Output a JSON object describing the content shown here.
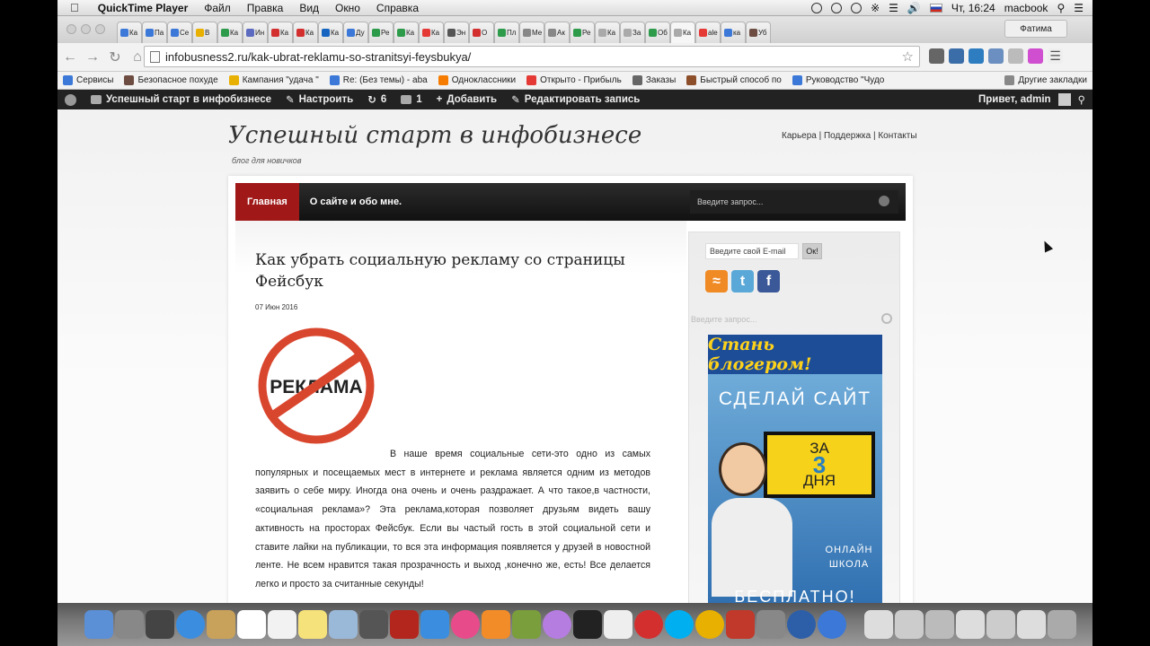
{
  "menubar": {
    "app_name": "QuickTime Player",
    "menus": [
      "Файл",
      "Правка",
      "Вид",
      "Окно",
      "Справка"
    ],
    "clock": "Чт, 16:24",
    "user": "macbook"
  },
  "browser": {
    "profile_name": "Фатима",
    "url": "infobusness2.ru/kak-ubrat-reklamu-so-stranitsyi-feysbukya/",
    "tabs": [
      {
        "label": "Ка",
        "color": "#3b78d8"
      },
      {
        "label": "Па",
        "color": "#3b78d8"
      },
      {
        "label": "Се",
        "color": "#3b78d8"
      },
      {
        "label": "В",
        "color": "#e8b000"
      },
      {
        "label": "Ка",
        "color": "#2e9b4b"
      },
      {
        "label": "Ин",
        "color": "#5c6bc0"
      },
      {
        "label": "Ка",
        "color": "#d32f2f"
      },
      {
        "label": "Ка",
        "color": "#d32f2f"
      },
      {
        "label": "Ка",
        "color": "#1565c0"
      },
      {
        "label": "Ду",
        "color": "#3b78d8"
      },
      {
        "label": "Ре",
        "color": "#2e9b4b"
      },
      {
        "label": "Ка",
        "color": "#2e9b4b"
      },
      {
        "label": "Ка",
        "color": "#e53935"
      },
      {
        "label": "Эн",
        "color": "#555555"
      },
      {
        "label": "О",
        "color": "#d32f2f"
      },
      {
        "label": "Пл",
        "color": "#2e9b4b"
      },
      {
        "label": "Ме",
        "color": "#888888"
      },
      {
        "label": "Ак",
        "color": "#888888"
      },
      {
        "label": "Ре",
        "color": "#2e9b4b"
      },
      {
        "label": "Ка",
        "color": "#aaaaaa"
      },
      {
        "label": "За",
        "color": "#aaaaaa"
      },
      {
        "label": "Об",
        "color": "#2e9b4b"
      },
      {
        "label": "Ка",
        "color": "#aaaaaa",
        "active": true
      },
      {
        "label": "ale",
        "color": "#e53935"
      },
      {
        "label": "ка",
        "color": "#3b78d8"
      },
      {
        "label": "Уб",
        "color": "#6d4c41"
      }
    ]
  },
  "bookmarks": [
    {
      "label": "Сервисы",
      "color": "#3b78d8"
    },
    {
      "label": "Безопасное похуде",
      "color": "#6d4c41"
    },
    {
      "label": "Кампания \"удача \"",
      "color": "#e8b000"
    },
    {
      "label": "Re: (Без темы) - aba",
      "color": "#3b78d8"
    },
    {
      "label": "Одноклассники",
      "color": "#f57c00"
    },
    {
      "label": "Открыто - Прибыль",
      "color": "#e53935"
    },
    {
      "label": "Заказы",
      "color": "#666666"
    },
    {
      "label": "Быстрый способ по",
      "color": "#8d4e2a"
    },
    {
      "label": "Руководство \"Чудо",
      "color": "#3b78d8"
    },
    {
      "label": "Другие закладки",
      "color": "#888888"
    }
  ],
  "wpbar": {
    "site_name": "Успешный старт в инфобизнесе",
    "customize": "Настроить",
    "updates": "6",
    "comments": "1",
    "add_new": "Добавить",
    "edit_post": "Редактировать запись",
    "greeting": "Привет, admin"
  },
  "site": {
    "title": "Успешный старт в инфобизнесе",
    "tagline": "блог для новичков",
    "top_links": "Карьера | Поддержка | Контакты",
    "nav_home": "Главная",
    "nav_about": "О сайте и обо мне.",
    "nav_search_placeholder": "Введите запрос..."
  },
  "post": {
    "title": "Как убрать социальную рекламу со страницы Фейсбук",
    "date": "07 Июн 2016",
    "image_text": "РЕКЛАМА",
    "body_first": "В наше время социальные сети-это одно из самых популярных и посещаемых мест в интернете и реклама является одним из методов заявить о себе миру. Иногда она очень и очень раздражает. А что такое,в частности, «социальная реклама»? Эта реклама,которая позволяет  друзьям видеть вашу активность на просторах Фейсбук. Если вы частый гость в этой социальной сети и ставите лайки на публикации, то вся эта информация появляется у друзей в новостной ленте. Не всем нравится такая прозрачность и выход ,конечно же, есть! Все делается легко и просто за считанные секунды!"
  },
  "sidebar": {
    "email_placeholder": "Введите свой E-mail",
    "email_button": "Ок!",
    "search_placeholder": "Введите запрос...",
    "banner_title": "Стань блогером!",
    "banner_line1": "СДЕЛАЙ САЙТ",
    "banner_za": "ЗА",
    "banner_num": "3",
    "banner_days": "ДНЯ",
    "banner_online": "ОНЛАЙН ШКОЛА",
    "banner_free": "БЕСПЛАТНО!"
  },
  "dock_apps": [
    {
      "name": "finder",
      "color": "#5b8fd6"
    },
    {
      "name": "launchpad",
      "color": "#888888"
    },
    {
      "name": "mission-control",
      "color": "#444444"
    },
    {
      "name": "safari",
      "color": "#3b8de0"
    },
    {
      "name": "contacts",
      "color": "#c8a15a"
    },
    {
      "name": "calendar",
      "color": "#ffffff"
    },
    {
      "name": "reminders",
      "color": "#f2f2f2"
    },
    {
      "name": "notes",
      "color": "#f6e27a"
    },
    {
      "name": "preview",
      "color": "#9ab8d8"
    },
    {
      "name": "facetime",
      "color": "#555555"
    },
    {
      "name": "photo-booth",
      "color": "#b3261e"
    },
    {
      "name": "app-store",
      "color": "#3b8de0"
    },
    {
      "name": "itunes",
      "color": "#e84b8a"
    },
    {
      "name": "ibooks",
      "color": "#f28c28"
    },
    {
      "name": "game",
      "color": "#7a9e3b"
    },
    {
      "name": "flower",
      "color": "#b57de0"
    },
    {
      "name": "activity-monitor",
      "color": "#222222"
    },
    {
      "name": "text-file",
      "color": "#eeeeee"
    },
    {
      "name": "opera",
      "color": "#d32f2f"
    },
    {
      "name": "skype",
      "color": "#00aff0"
    },
    {
      "name": "chrome",
      "color": "#e8b000"
    },
    {
      "name": "photo-app",
      "color": "#c0392b"
    },
    {
      "name": "system-preferences",
      "color": "#888888"
    },
    {
      "name": "quicktime",
      "color": "#2d5fa8"
    },
    {
      "name": "network",
      "color": "#3b78d8"
    },
    {
      "name": "window1",
      "color": "#dddddd"
    },
    {
      "name": "window2",
      "color": "#cccccc"
    },
    {
      "name": "window3",
      "color": "#bbbbbb"
    },
    {
      "name": "window4",
      "color": "#dddddd"
    },
    {
      "name": "window5",
      "color": "#cccccc"
    },
    {
      "name": "window6",
      "color": "#dddddd"
    },
    {
      "name": "trash",
      "color": "#aaaaaa"
    }
  ]
}
